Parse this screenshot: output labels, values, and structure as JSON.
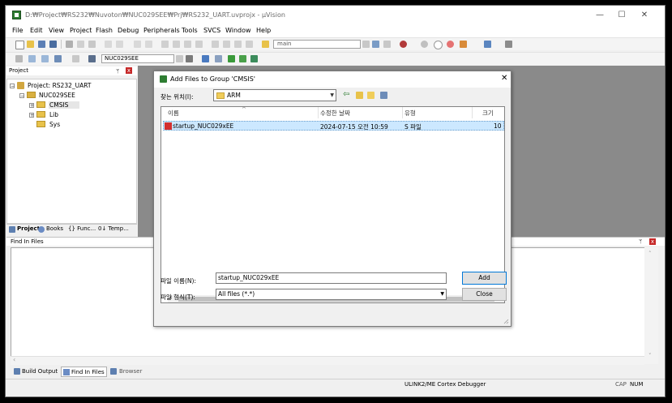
{
  "window": {
    "title": "D:₩Project₩RS232₩Nuvoton₩NUC029SEE₩Prj₩RS232_UART.uvprojx - µVision",
    "min": "—",
    "max": "☐",
    "close": "✕"
  },
  "menu": [
    "File",
    "Edit",
    "View",
    "Project",
    "Flash",
    "Debug",
    "Peripherals",
    "Tools",
    "SVCS",
    "Window",
    "Help"
  ],
  "toolbar": {
    "find_combo": "main",
    "target_combo": "NUC029SEE"
  },
  "project_panel": {
    "title": "Project",
    "pin": "ᛘ",
    "close": "x",
    "tree": {
      "root": "Project: RS232_UART",
      "target": "NUC029SEE",
      "groups": [
        "CMSIS",
        "Lib",
        "Sys"
      ]
    },
    "tabs": [
      "Project",
      "Books",
      "{} Func...",
      "0↓ Temp..."
    ]
  },
  "find_panel": {
    "title": "Find In Files",
    "pin": "ᛘ",
    "close": "x"
  },
  "bottom_tabs": [
    "Build Output",
    "Find In Files",
    "Browser"
  ],
  "statusbar": {
    "debugger": "ULINK2/ME Cortex Debugger",
    "cap": "CAP",
    "num": "NUM"
  },
  "dialog": {
    "title": "Add Files to Group 'CMSIS'",
    "close": "✕",
    "look_in_label": "찾는 위치(I):",
    "look_in_value": "ARM",
    "columns": [
      "이름",
      "수정한 날짜",
      "유형",
      "크기"
    ],
    "files": [
      {
        "name": "startup_NUC029xEE",
        "modified": "2024-07-15 오전 10:59",
        "type": "S 파일",
        "size": "10"
      }
    ],
    "filename_label": "파일 이름(N):",
    "filename_value": "startup_NUC029xEE",
    "filetype_label": "파일 형식(T):",
    "filetype_value": "All files (*.*)",
    "add_button": "Add",
    "close_button": "Close"
  }
}
